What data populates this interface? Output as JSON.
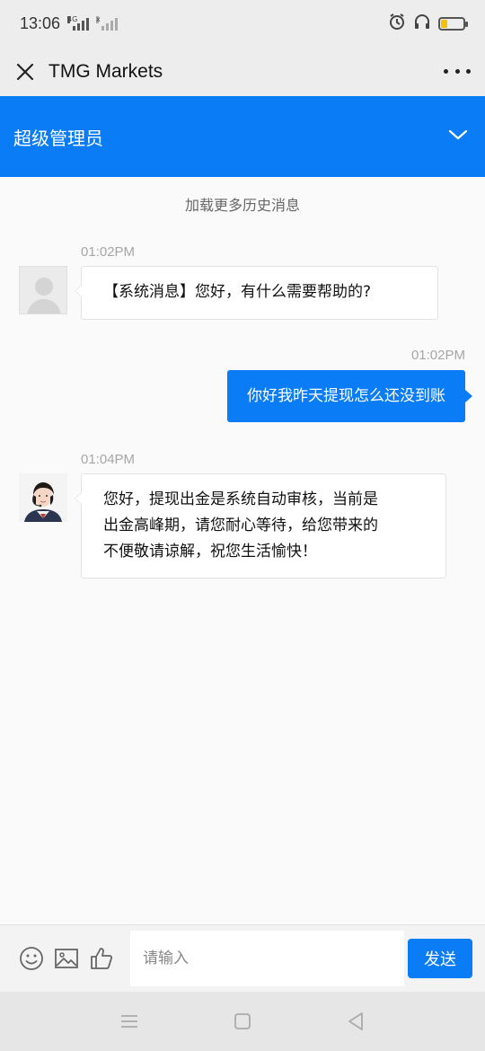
{
  "status_bar": {
    "time": "13:06",
    "network_tag": "4G",
    "sim2_tag": "x",
    "battery_level": 0.25,
    "battery_color": "#f2c200"
  },
  "title_bar": {
    "title": "TMG Markets",
    "close_icon": "close-icon",
    "more_icon": "more-icon"
  },
  "agent_header": {
    "name": "超级管理员",
    "background": "#0a7cf5",
    "chevron_icon": "chevron-down-icon"
  },
  "chat": {
    "load_more": "加载更多历史消息",
    "messages": [
      {
        "direction": "incoming",
        "time": "01:02PM",
        "avatar": "default-avatar",
        "text": "【系统消息】您好，有什么需要帮助的?"
      },
      {
        "direction": "outgoing",
        "time": "01:02PM",
        "text": "你好我昨天提现怎么还没到账"
      },
      {
        "direction": "incoming",
        "time": "01:04PM",
        "avatar": "agent-avatar",
        "text_lines": [
          "您好，提现出金是系统自动审核，当前是",
          "出金高峰期，请您耐心等待，给您带来的",
          "不便敬请谅解，祝您生活愉快！"
        ]
      }
    ]
  },
  "input_bar": {
    "placeholder": "请输入",
    "value": "",
    "send_label": "发送",
    "tools": [
      "emoji-icon",
      "image-icon",
      "thumbs-up-icon"
    ]
  },
  "nav_bar": {
    "buttons": [
      "menu-icon",
      "home-icon",
      "back-icon"
    ]
  }
}
